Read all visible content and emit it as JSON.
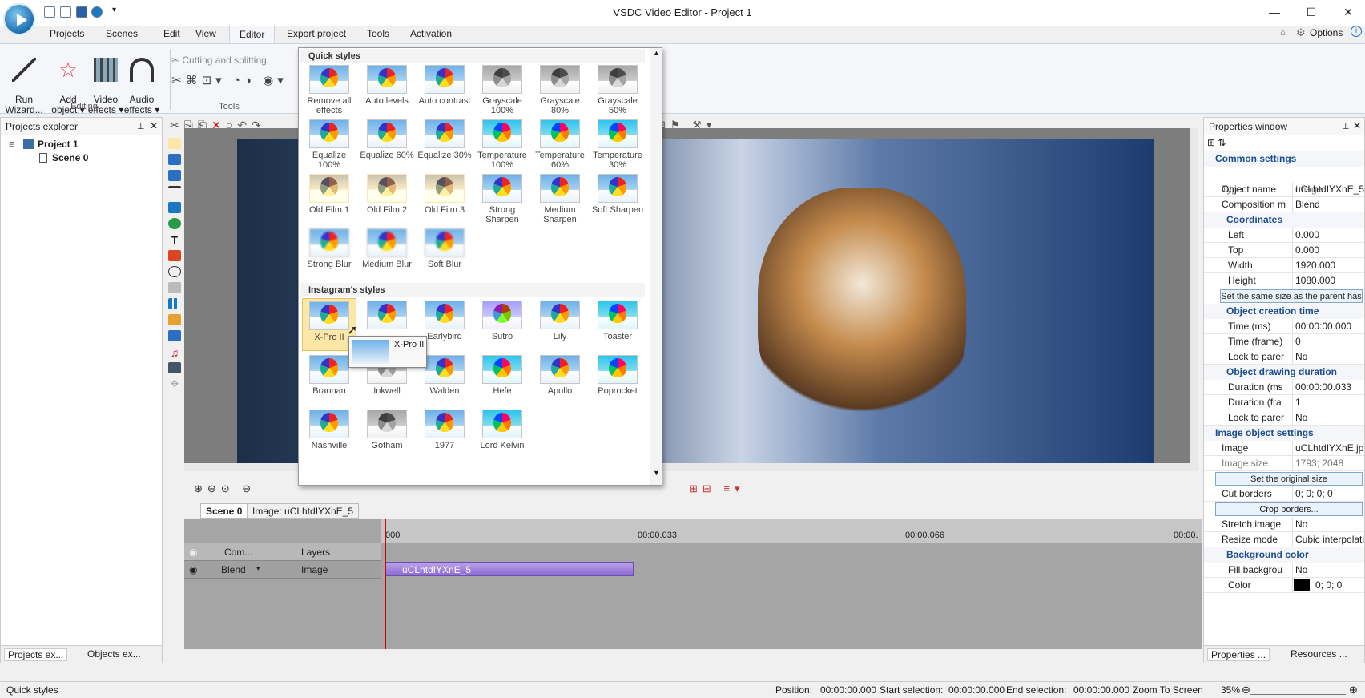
{
  "window": {
    "title": "VSDC Video Editor - Project 1",
    "min": "—",
    "max": "☐",
    "close": "✕"
  },
  "menu": [
    "Projects",
    "Scenes",
    "Edit",
    "View",
    "Editor",
    "Export project",
    "Tools",
    "Activation"
  ],
  "menu_active": "Editor",
  "options_label": "Options",
  "ribbon": {
    "run": "Run\nWizard...",
    "add": "Add\nobject",
    "video": "Video\neffects",
    "audio": "Audio\neffects",
    "cutting": "Cutting and splitting",
    "editing_group": "Editing",
    "tools_group": "Tools"
  },
  "explorer": {
    "title": "Projects explorer",
    "project": "Project 1",
    "scene": "Scene 0",
    "tab1": "Projects ex...",
    "tab2": "Objects ex..."
  },
  "quick_styles": {
    "header": "Quick styles",
    "items": [
      "Remove all effects",
      "Auto levels",
      "Auto contrast",
      "Grayscale 100%",
      "Grayscale 80%",
      "Grayscale 50%",
      "Equalize 100%",
      "Equalize 60%",
      "Equalize 30%",
      "Temperature 100%",
      "Temperature 60%",
      "Temperature 30%",
      "Old Film 1",
      "Old Film 2",
      "Old Film 3",
      "Strong Sharpen",
      "Medium Sharpen",
      "Soft Sharpen",
      "Strong Blur",
      "Medium Blur",
      "Soft Blur"
    ],
    "insta_header": "Instagram's styles",
    "insta": [
      "X-Pro II",
      "",
      "Earlybird",
      "Sutro",
      "Lily",
      "Toaster",
      "Brannan",
      "Inkwell",
      "Walden",
      "Hefe",
      "Apollo",
      "Poprocket",
      "Nashville",
      "Gotham",
      "1977",
      "Lord Kelvin"
    ],
    "tooltip": "X-Pro II"
  },
  "timeline": {
    "tab_scene": "Scene 0",
    "tab_image": "Image: uCLhtdIYXnE_5",
    "t0": "000",
    "t1": "00:00.033",
    "t2": "00:00.066",
    "t3": "00:00.",
    "col_com": "Com...",
    "col_layers": "Layers",
    "row_blend": "Blend",
    "row_image": "Image",
    "clip": "uCLhtdIYXnE_5"
  },
  "properties": {
    "title": "Properties window",
    "common": "Common settings",
    "type_k": "Type",
    "type_v": "Image",
    "name_k": "Object name",
    "name_v": "uCLhtdIYXnE_5",
    "comp_k": "Composition m",
    "comp_v": "Blend",
    "coords": "Coordinates",
    "left_k": "Left",
    "left_v": "0.000",
    "top_k": "Top",
    "top_v": "0.000",
    "width_k": "Width",
    "width_v": "1920.000",
    "height_k": "Height",
    "height_v": "1080.000",
    "same_size": "Set the same size as the parent has",
    "creation": "Object creation time",
    "tms_k": "Time (ms)",
    "tms_v": "00:00:00.000",
    "tfr_k": "Time (frame)",
    "tfr_v": "0",
    "lock1_k": "Lock to parer",
    "lock1_v": "No",
    "drawing": "Object drawing duration",
    "dms_k": "Duration (ms",
    "dms_v": "00:00:00.033",
    "dfr_k": "Duration (fra",
    "dfr_v": "1",
    "lock2_k": "Lock to parer",
    "lock2_v": "No",
    "imgset": "Image object settings",
    "img_k": "Image",
    "img_v": "uCLhtdIYXnE.jpg;",
    "isz_k": "Image size",
    "isz_v": "1793; 2048",
    "orig": "Set the original size",
    "cut_k": "Cut borders",
    "cut_v": "0; 0; 0; 0",
    "crop": "Crop borders...",
    "stretch_k": "Stretch image",
    "stretch_v": "No",
    "resize_k": "Resize mode",
    "resize_v": "Cubic interpolatic",
    "bg": "Background color",
    "fill_k": "Fill backgrou",
    "fill_v": "No",
    "color_k": "Color",
    "color_v": "0; 0; 0",
    "tab1": "Properties ...",
    "tab2": "Resources ..."
  },
  "status": {
    "left": "Quick styles",
    "pos_k": "Position:",
    "pos_v": "00:00:00.000",
    "ss_k": "Start selection:",
    "ss_v": "00:00:00.000",
    "es_k": "End selection:",
    "es_v": "00:00:00.000",
    "zoom_label": "Zoom To Screen",
    "zoom": "35%"
  }
}
